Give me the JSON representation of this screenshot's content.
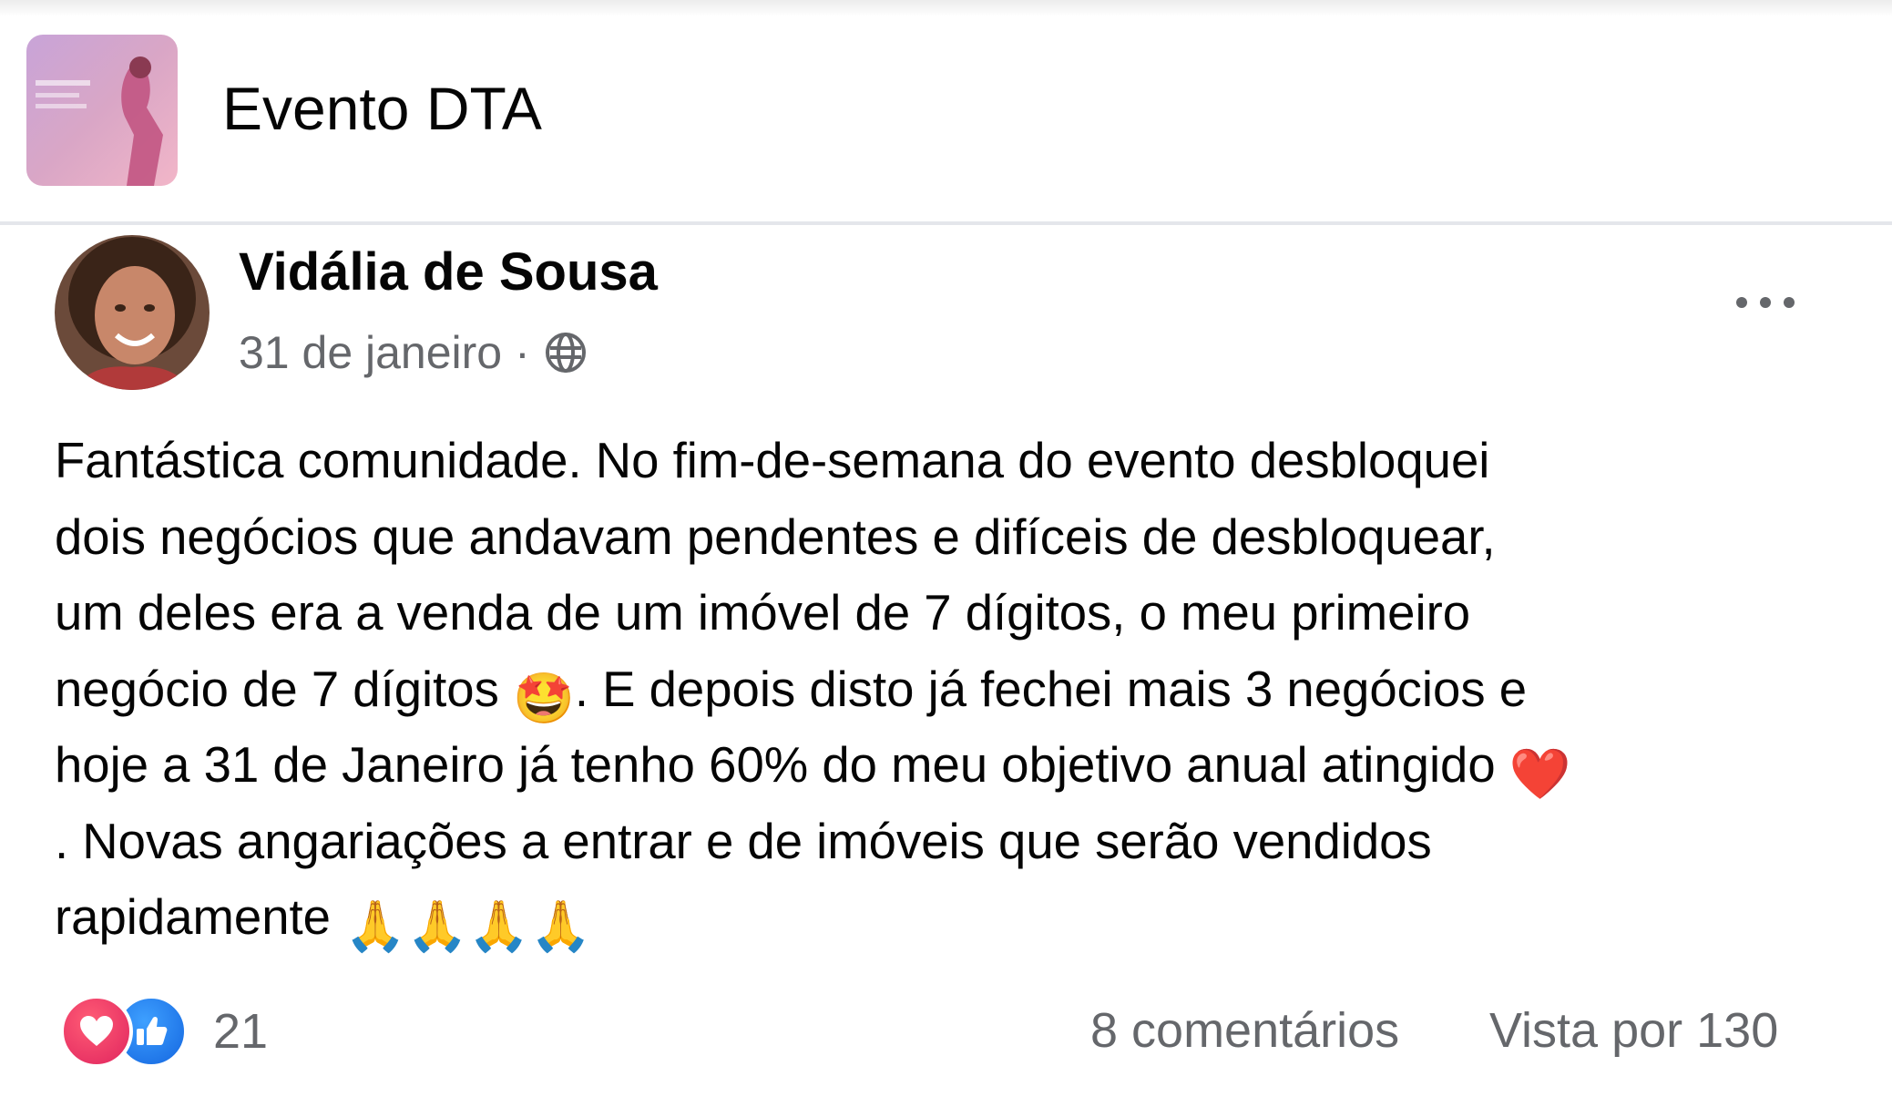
{
  "group": {
    "name": "Evento DTA",
    "thumbnail_icon": "group-cover-image"
  },
  "post": {
    "author": "Vidália de Sousa",
    "date": "31 de janeiro",
    "meta_separator": "·",
    "audience_icon": "globe-icon",
    "more_icon": "more-options-icon",
    "body_lines": [
      {
        "text": "Fantástica comunidade. No fim-de-semana do evento desbloquei"
      },
      {
        "text": "dois negócios que andavam pendentes e difíceis de desbloquear,"
      },
      {
        "text": "um deles era a venda de um imóvel de 7 dígitos, o meu primeiro"
      },
      {
        "before": "negócio de 7 dígitos ",
        "emoji": "🤩",
        "after": ". E depois disto já fechei mais 3 negócios e"
      },
      {
        "before": "hoje a 31 de Janeiro já tenho 60% do meu objetivo anual atingido ",
        "emoji": "❤️",
        "after": ""
      },
      {
        "text": ". Novas angariações a entrar e de imóveis que serão vendidos"
      },
      {
        "before": "rapidamente ",
        "emoji": "🙏🙏🙏🙏",
        "after": ""
      }
    ]
  },
  "footer": {
    "reaction_icons": [
      "love-reaction-icon",
      "like-reaction-icon"
    ],
    "reaction_count": "21",
    "comments": "8 comentários",
    "seen_by": "Vista por 130"
  },
  "colors": {
    "text_primary": "#050505",
    "text_secondary": "#65676b",
    "divider": "#e4e6eb",
    "love": "#e0245e",
    "like": "#1877f2"
  }
}
